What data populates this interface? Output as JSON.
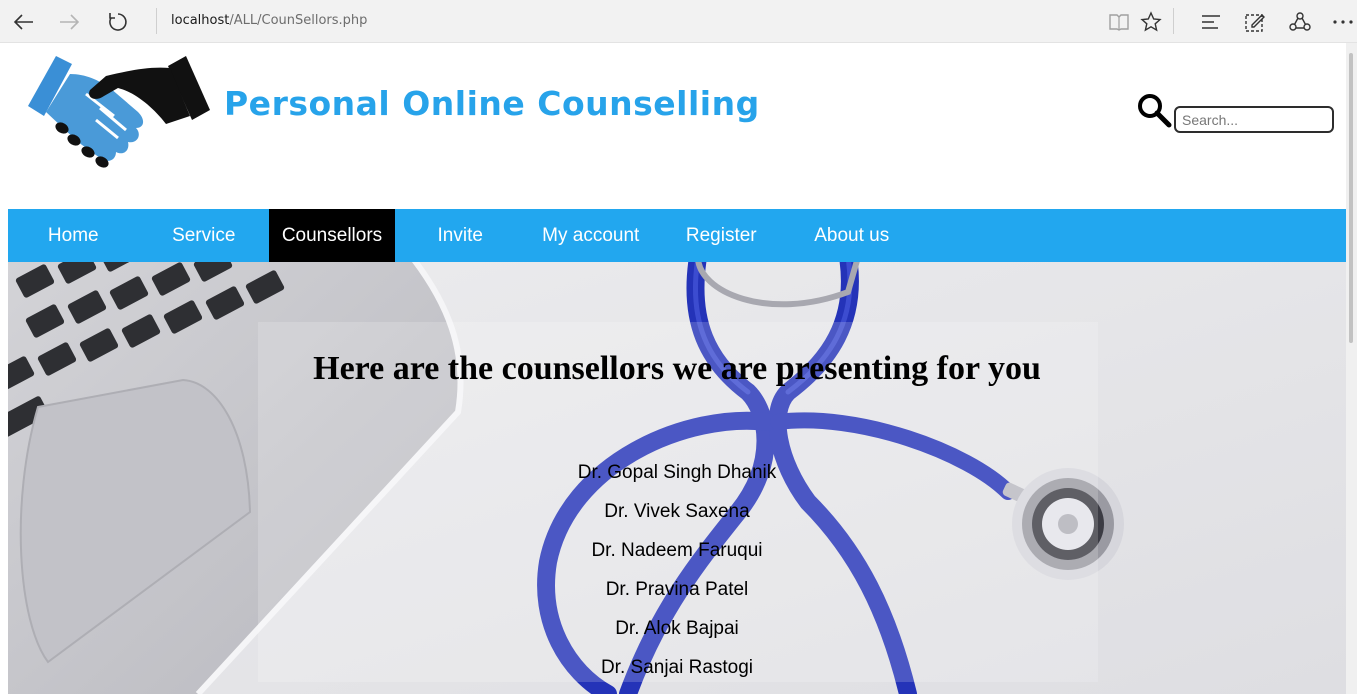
{
  "browser": {
    "address_host": "localhost",
    "address_path": "/ALL/CounSellors.php",
    "icons": [
      "back-arrow-icon",
      "forward-arrow-icon",
      "refresh-icon",
      "reading-view-icon",
      "favorite-star-icon",
      "hub-icon",
      "web-note-icon",
      "share-icon",
      "more-icon"
    ]
  },
  "header": {
    "site_title": "Personal Online Counselling",
    "search_placeholder": "Search..."
  },
  "nav": {
    "items": [
      "Home",
      "Service",
      "Counsellors",
      "Invite",
      "My account",
      "Register",
      "About us"
    ],
    "active": "Counsellors"
  },
  "main": {
    "heading": "Here are the counsellors we are presenting for you",
    "counsellors": [
      "Dr. Gopal Singh Dhanik",
      "Dr. Vivek Saxena",
      "Dr. Nadeem Faruqui",
      "Dr. Pravina Patel",
      "Dr. Alok Bajpai",
      "Dr. Sanjai Rastogi"
    ]
  },
  "colors": {
    "brand_blue": "#27a3ea",
    "nav_blue": "#22a7ef",
    "nav_active": "#000000"
  }
}
